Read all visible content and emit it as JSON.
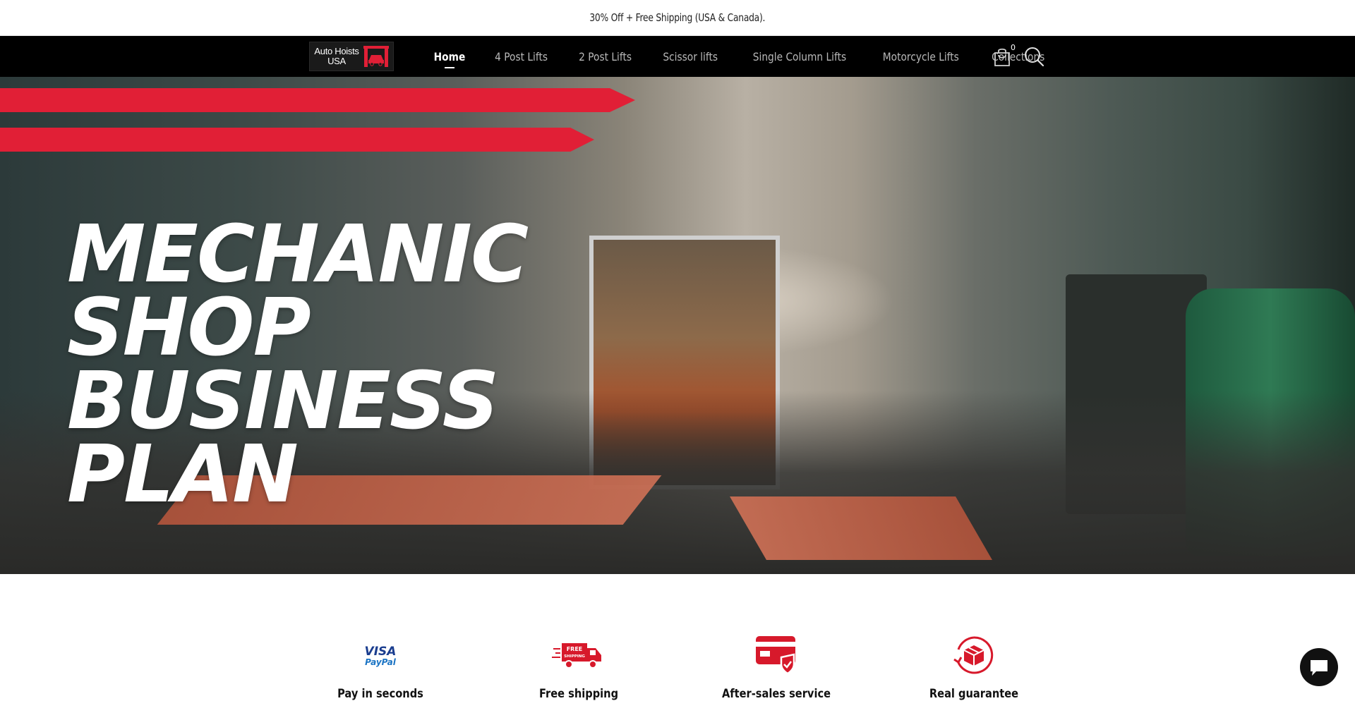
{
  "announcement": {
    "text": "30% Off + Free Shipping (USA & Canada)."
  },
  "header": {
    "logo": {
      "line1": "Auto Hoists",
      "line2": "USA",
      "icon": "car-lift-icon"
    },
    "nav": [
      {
        "label": "Home",
        "active": true
      },
      {
        "label": "4 Post Lifts",
        "active": false
      },
      {
        "label": "2 Post Lifts",
        "active": false
      },
      {
        "label": "Scissor lifts",
        "active": false
      },
      {
        "label": "Single Column Lifts",
        "active": false
      },
      {
        "label": "Motorcycle Lifts",
        "active": false
      },
      {
        "label": "Collections",
        "active": false
      }
    ],
    "cart": {
      "count": "0",
      "icon": "shopping-bag-icon"
    },
    "search": {
      "icon": "search-icon"
    }
  },
  "hero": {
    "title_lines": [
      "MECHANIC",
      "SHOP",
      "BUSINESS",
      "PLAN"
    ],
    "accent_color": "#e11f36"
  },
  "features": [
    {
      "title": "Pay in seconds",
      "icon": "visa-paypal-icon",
      "icon_text_1": "VISA",
      "icon_text_2": "PayPal"
    },
    {
      "title": "Free shipping",
      "icon": "free-shipping-truck-icon",
      "icon_text_1": "FREE",
      "icon_text_2": "SHIPPING"
    },
    {
      "title": "After-sales service",
      "icon": "card-check-icon"
    },
    {
      "title": "Real guarantee",
      "icon": "box-return-icon"
    }
  ],
  "colors": {
    "brand_red": "#e11f36",
    "nav_bg": "#000000",
    "icon_red": "#d7192b"
  },
  "chat": {
    "icon": "chat-bubble-icon"
  }
}
